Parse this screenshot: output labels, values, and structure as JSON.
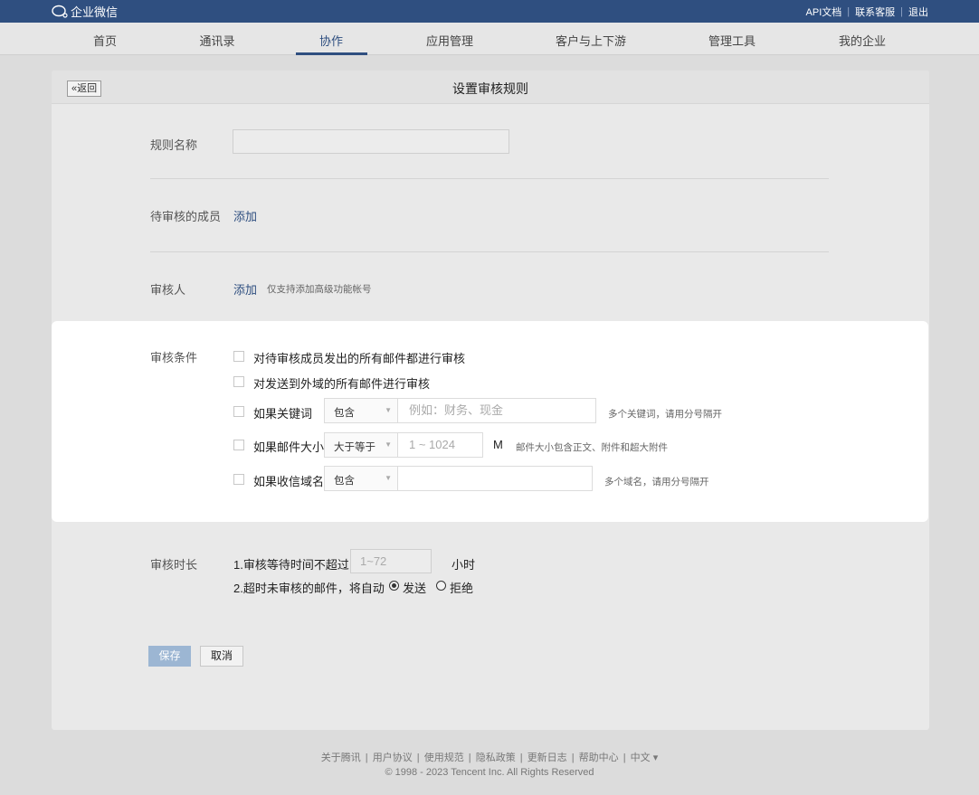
{
  "topbar": {
    "brand": "企业微信",
    "links": [
      "API文档",
      "联系客服",
      "退出"
    ]
  },
  "nav": {
    "items": [
      "首页",
      "通讯录",
      "协作",
      "应用管理",
      "客户与上下游",
      "管理工具",
      "我的企业"
    ],
    "active": "协作"
  },
  "page": {
    "back_label": "«返回",
    "title": "设置审核规则"
  },
  "form": {
    "rule_name_label": "规则名称",
    "rule_name_value": "",
    "members_label": "待审核的成员",
    "members_add": "添加",
    "reviewer_label": "审核人",
    "reviewer_add": "添加",
    "reviewer_hint": "仅支持添加高级功能帐号",
    "conditions_label": "审核条件",
    "conditions": {
      "all_mail": "对待审核成员发出的所有邮件都进行审核",
      "external": "对发送到外域的所有邮件进行审核",
      "keyword": {
        "label": "如果关键词",
        "select": "包含",
        "placeholder": "例如：财务、现金",
        "hint": "多个关键词，请用分号隔开"
      },
      "size": {
        "label": "如果邮件大小",
        "select": "大于等于",
        "placeholder": "1 ~ 1024",
        "unit": "M",
        "hint": "邮件大小包含正文、附件和超大附件"
      },
      "domain": {
        "label": "如果收信域名",
        "select": "包含",
        "placeholder": "",
        "hint": "多个域名，请用分号隔开"
      }
    },
    "duration_label": "审核时长",
    "duration_line1_prefix": "1.审核等待时间不超过",
    "duration_placeholder": "1~72",
    "duration_unit": "小时",
    "duration_line2": "2.超时未审核的邮件，将自动",
    "option_send": "发送",
    "option_reject": "拒绝",
    "selected_option": "发送"
  },
  "actions": {
    "save": "保存",
    "cancel": "取消"
  },
  "footer": {
    "links": [
      "关于腾讯",
      "用户协议",
      "使用规范",
      "隐私政策",
      "更新日志",
      "帮助中心",
      "中文 ▾"
    ],
    "copyright": "© 1998 - 2023 Tencent Inc. All Rights Reserved"
  }
}
